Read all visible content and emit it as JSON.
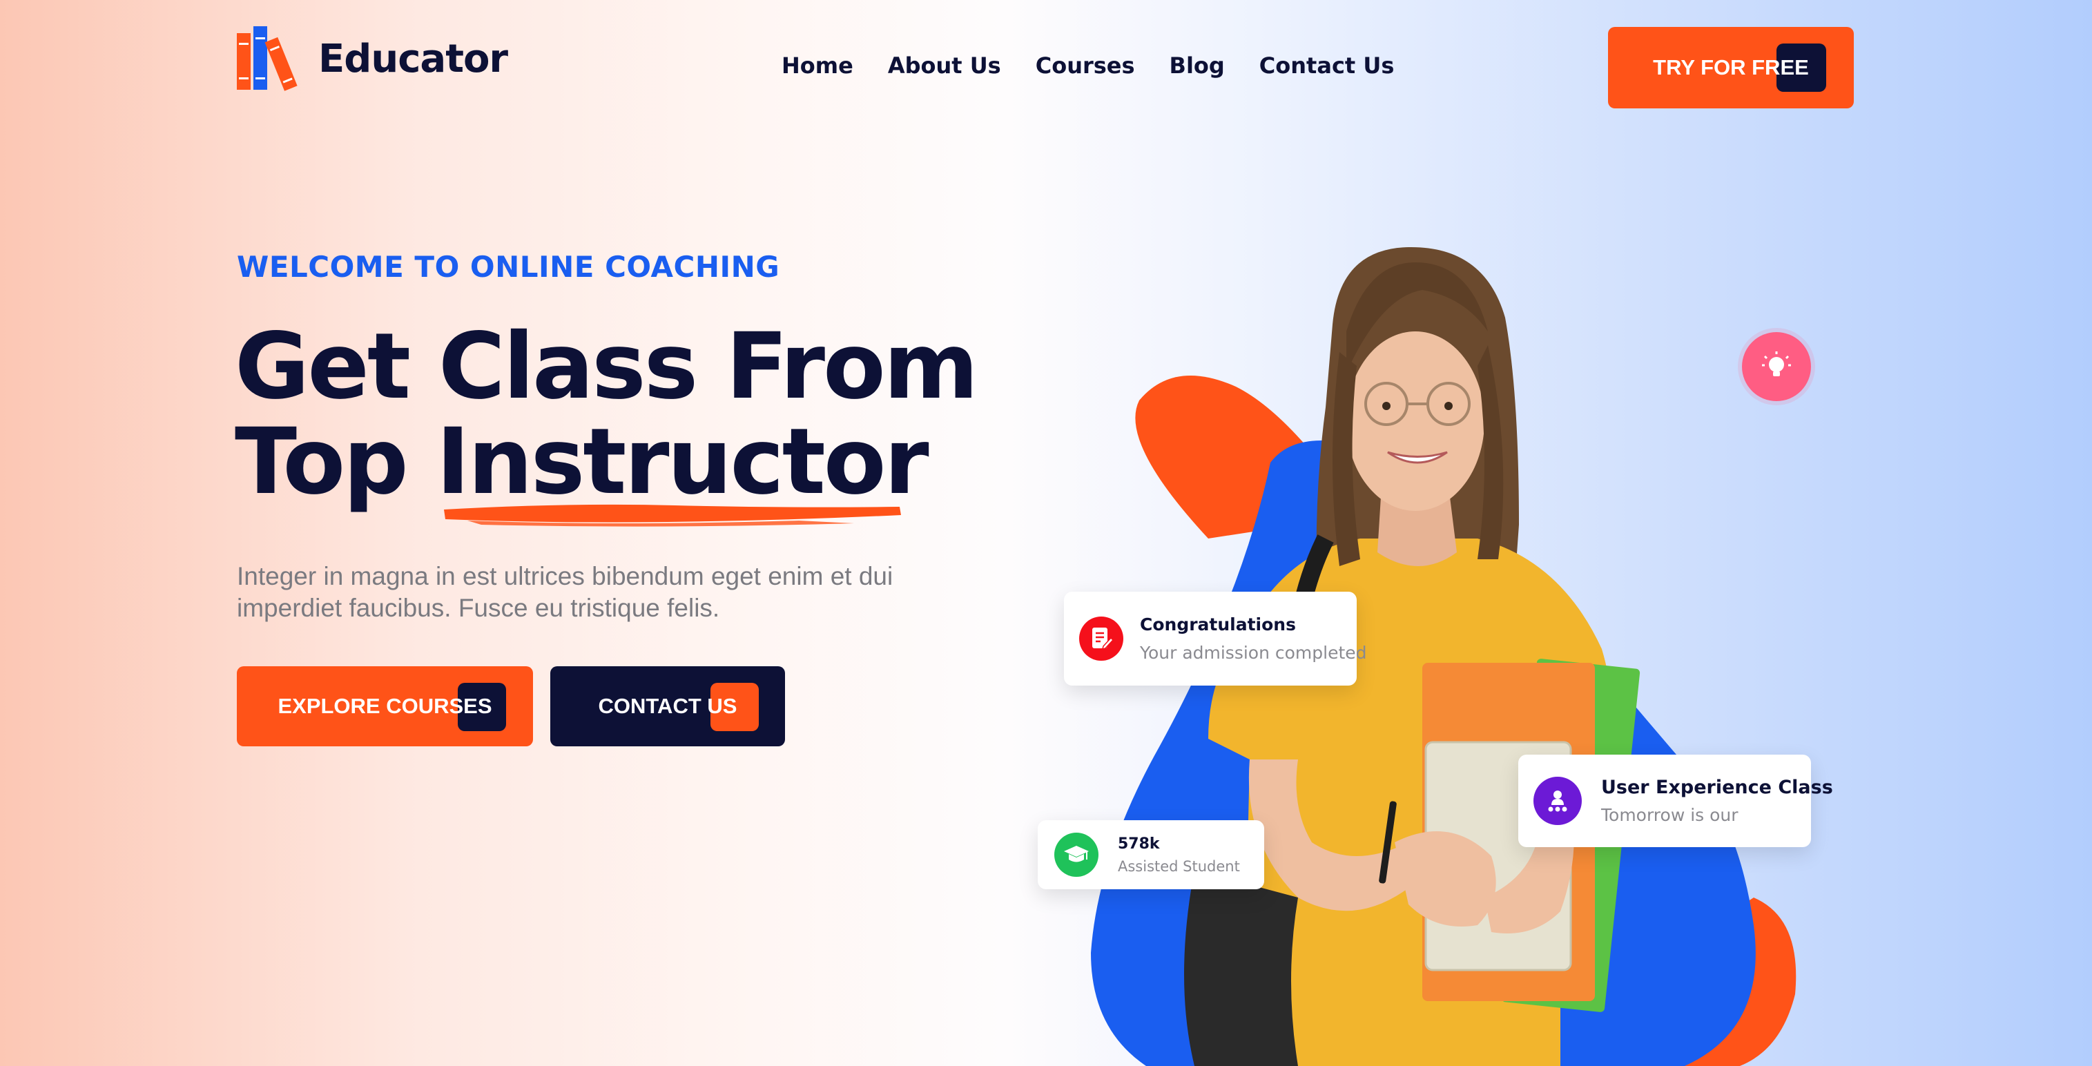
{
  "brand": {
    "name": "Educator"
  },
  "nav": {
    "items": [
      {
        "label": "Home"
      },
      {
        "label": "About Us"
      },
      {
        "label": "Courses"
      },
      {
        "label": "Blog"
      },
      {
        "label": "Contact Us"
      }
    ],
    "cta_label": "TRY FOR FREE"
  },
  "hero": {
    "eyebrow": "WELCOME TO ONLINE COACHING",
    "headline_line1": "Get Class From",
    "headline_line2": "Top Instructor",
    "description": "Integer in magna in est ultrices bibendum eget enim et dui imperdiet faucibus. Fusce eu tristique felis.",
    "explore_label": "EXPLORE COURSES",
    "contact_label": "CONTACT US"
  },
  "cards": {
    "congrats": {
      "title": "Congratulations",
      "subtitle": "Your admission completed",
      "icon": "document-edit-icon"
    },
    "ux_class": {
      "title": "User Experience Class",
      "subtitle": "Tomorrow is our",
      "icon": "student-group-icon"
    },
    "students": {
      "title": "578k",
      "subtitle": "Assisted Student",
      "icon": "graduation-cap-icon"
    }
  },
  "colors": {
    "accent": "#ff5318",
    "navy": "#0d1136",
    "blue": "#1a5ef0",
    "pink": "#ff5d83",
    "green": "#1fc25a",
    "purple": "#6c1ad6",
    "red": "#f5101b"
  }
}
